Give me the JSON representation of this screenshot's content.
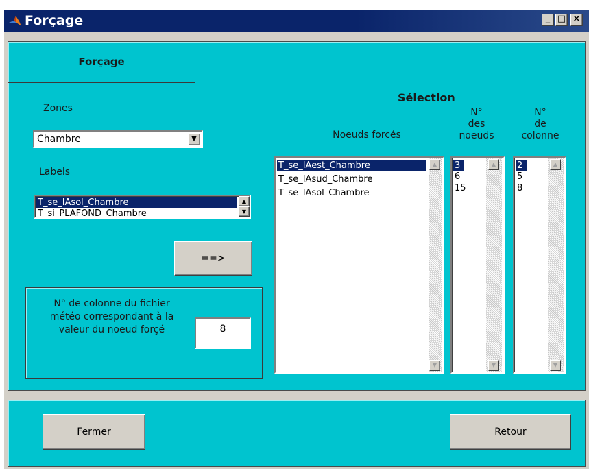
{
  "window": {
    "title": "Forçage"
  },
  "header": {
    "tab_label": "Forçage"
  },
  "left": {
    "zones_label": "Zones",
    "zones_selected": "Chambre",
    "labels_label": "Labels",
    "labels_items": [
      "T_se_IAsol_Chambre",
      "T_si_PLAFOND_Chambre"
    ],
    "add_button": "==>",
    "column_caption": "N° de colonne du fichier météo correspondant à la valeur du noeud forçé",
    "column_value": "8"
  },
  "selection": {
    "title": "Sélection",
    "col1_header": "Noeuds forcés",
    "col2_header": [
      "N°",
      "des",
      "noeuds"
    ],
    "col3_header": [
      "N°",
      "de",
      "colonne"
    ],
    "noeuds": [
      "T_se_IAest_Chambre",
      "T_se_IAsud_Chambre",
      "T_se_IAsol_Chambre"
    ],
    "numeros": [
      "3",
      "6",
      "15"
    ],
    "colonnes": [
      "2",
      "5",
      "8"
    ]
  },
  "footer": {
    "close_button": "Fermer",
    "back_button": "Retour"
  }
}
